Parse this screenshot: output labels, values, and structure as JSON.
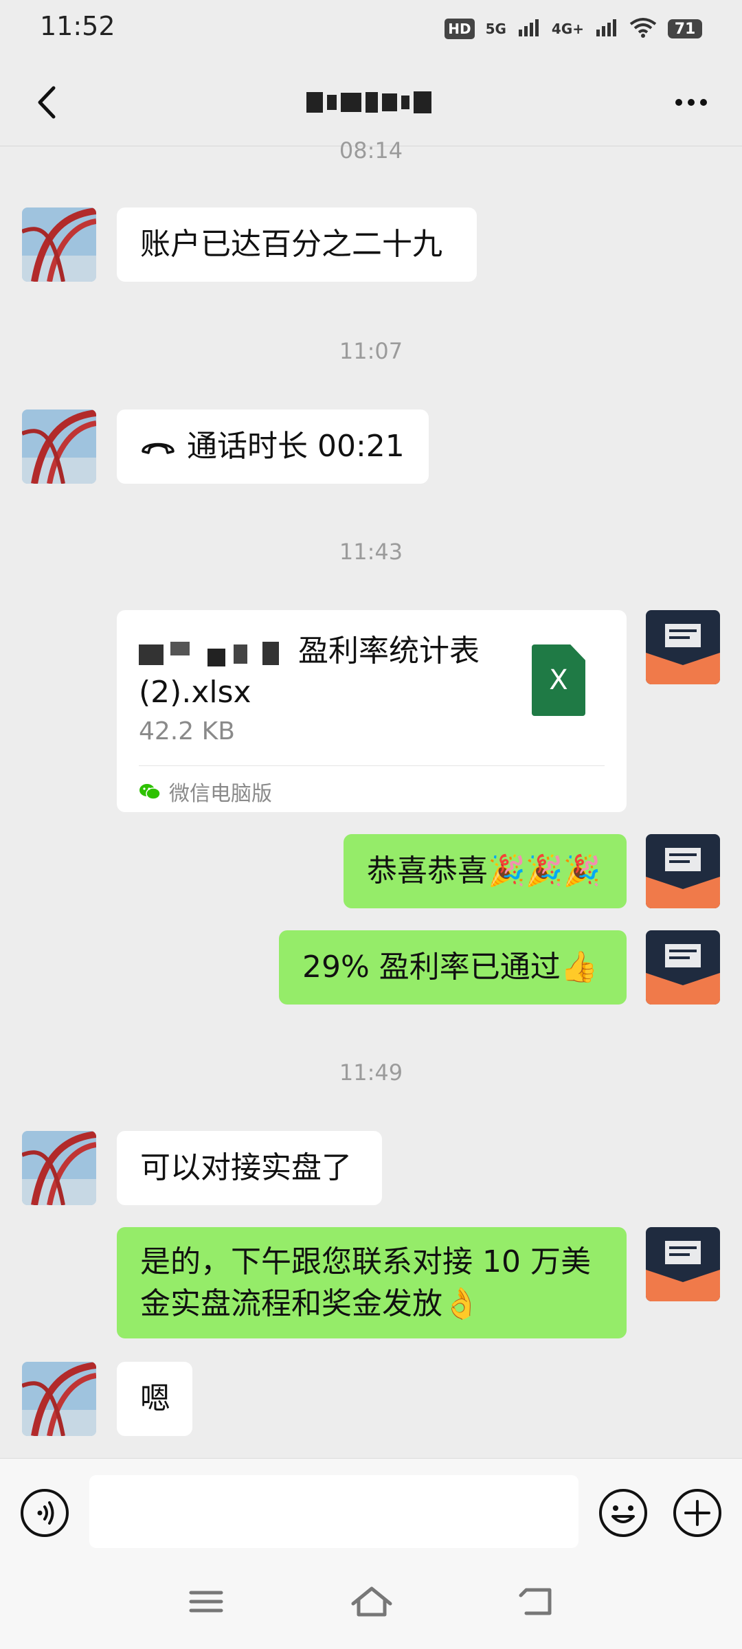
{
  "status_bar": {
    "time": "11:52",
    "hd": "HD",
    "net1": "5G",
    "net2": "4G+",
    "battery": "71"
  },
  "header": {
    "title": ""
  },
  "messages": [
    {
      "type": "time",
      "text": "08:14"
    },
    {
      "type": "text",
      "side": "in",
      "text": "账户已达百分之二十九"
    },
    {
      "type": "time",
      "text": "11:07"
    },
    {
      "type": "call",
      "side": "in",
      "text": "通话时长 00:21"
    },
    {
      "type": "time",
      "text": "11:43"
    },
    {
      "type": "file",
      "side": "out",
      "name_line1": "盈利率统计表",
      "name_line2": "(2).xlsx",
      "size": "42.2 KB",
      "source": "微信电脑版",
      "file_icon_letter": "X"
    },
    {
      "type": "text",
      "side": "out",
      "text": "恭喜恭喜🎉🎉🎉"
    },
    {
      "type": "text",
      "side": "out",
      "text": "29% 盈利率已通过👍"
    },
    {
      "type": "time",
      "text": "11:49"
    },
    {
      "type": "text",
      "side": "in",
      "text": "可以对接实盘了"
    },
    {
      "type": "text",
      "side": "out",
      "text": "是的，下午跟您联系对接 10 万美金实盘流程和奖金发放👌"
    },
    {
      "type": "text",
      "side": "in",
      "text": "嗯"
    }
  ],
  "colors": {
    "outgoing_bubble": "#95ec69",
    "incoming_bubble": "#ffffff",
    "background": "#ededed",
    "excel_green": "#1f7a45"
  },
  "input": {
    "placeholder": ""
  },
  "icons": [
    "back-icon",
    "more-icon",
    "phone-icon",
    "excel-icon",
    "wechat-icon",
    "voice-icon",
    "emoji-icon",
    "plus-icon",
    "menu-icon",
    "home-icon",
    "return-icon"
  ]
}
